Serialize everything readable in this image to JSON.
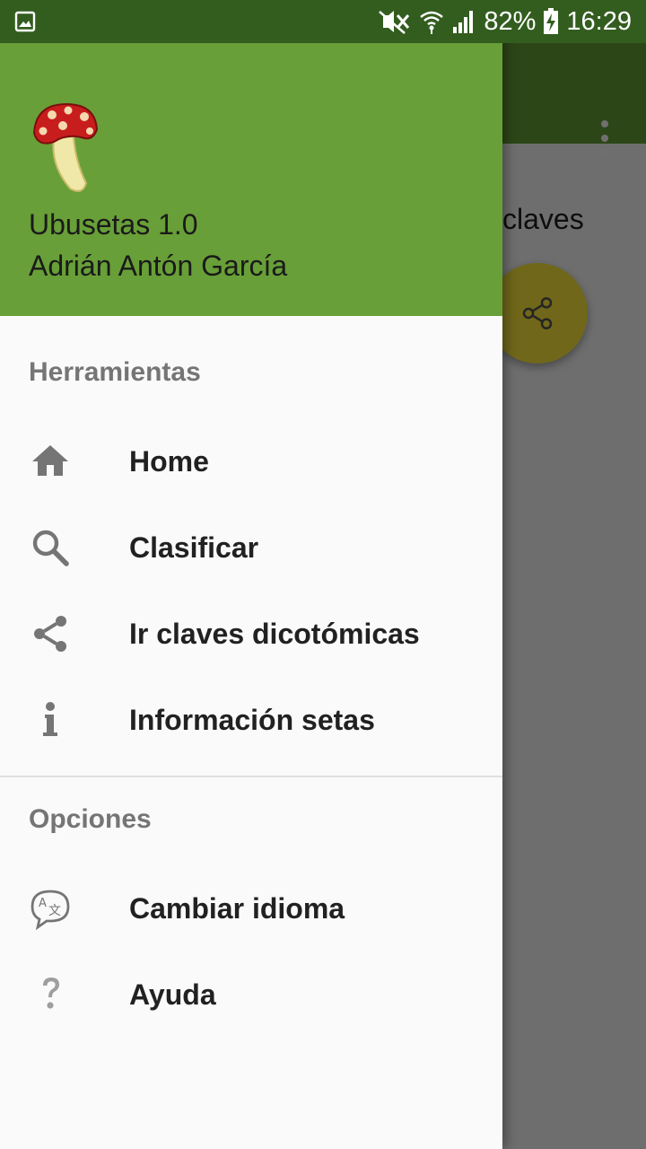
{
  "status_bar": {
    "battery": "82%",
    "time": "16:29",
    "icons": [
      "gallery-icon",
      "mute-icon",
      "wifi-icon",
      "signal-icon",
      "battery-charging-icon"
    ]
  },
  "background": {
    "content_text": "claves",
    "toolbar_color": "#689f38",
    "fab_color": "#ffeb3b"
  },
  "drawer": {
    "header": {
      "logo": "mushroom-logo",
      "title": "Ubusetas 1.0",
      "author": "Adrián Antón García",
      "color": "#689f38"
    },
    "sections": [
      {
        "title": "Herramientas",
        "items": [
          {
            "label": "Home",
            "icon": "home-icon"
          },
          {
            "label": "Clasificar",
            "icon": "search-icon"
          },
          {
            "label": "Ir claves dicotómicas",
            "icon": "share-icon"
          },
          {
            "label": "Información setas",
            "icon": "info-icon"
          }
        ]
      },
      {
        "title": "Opciones",
        "items": [
          {
            "label": "Cambiar idioma",
            "icon": "translate-icon"
          },
          {
            "label": "Ayuda",
            "icon": "help-icon"
          }
        ]
      }
    ]
  }
}
